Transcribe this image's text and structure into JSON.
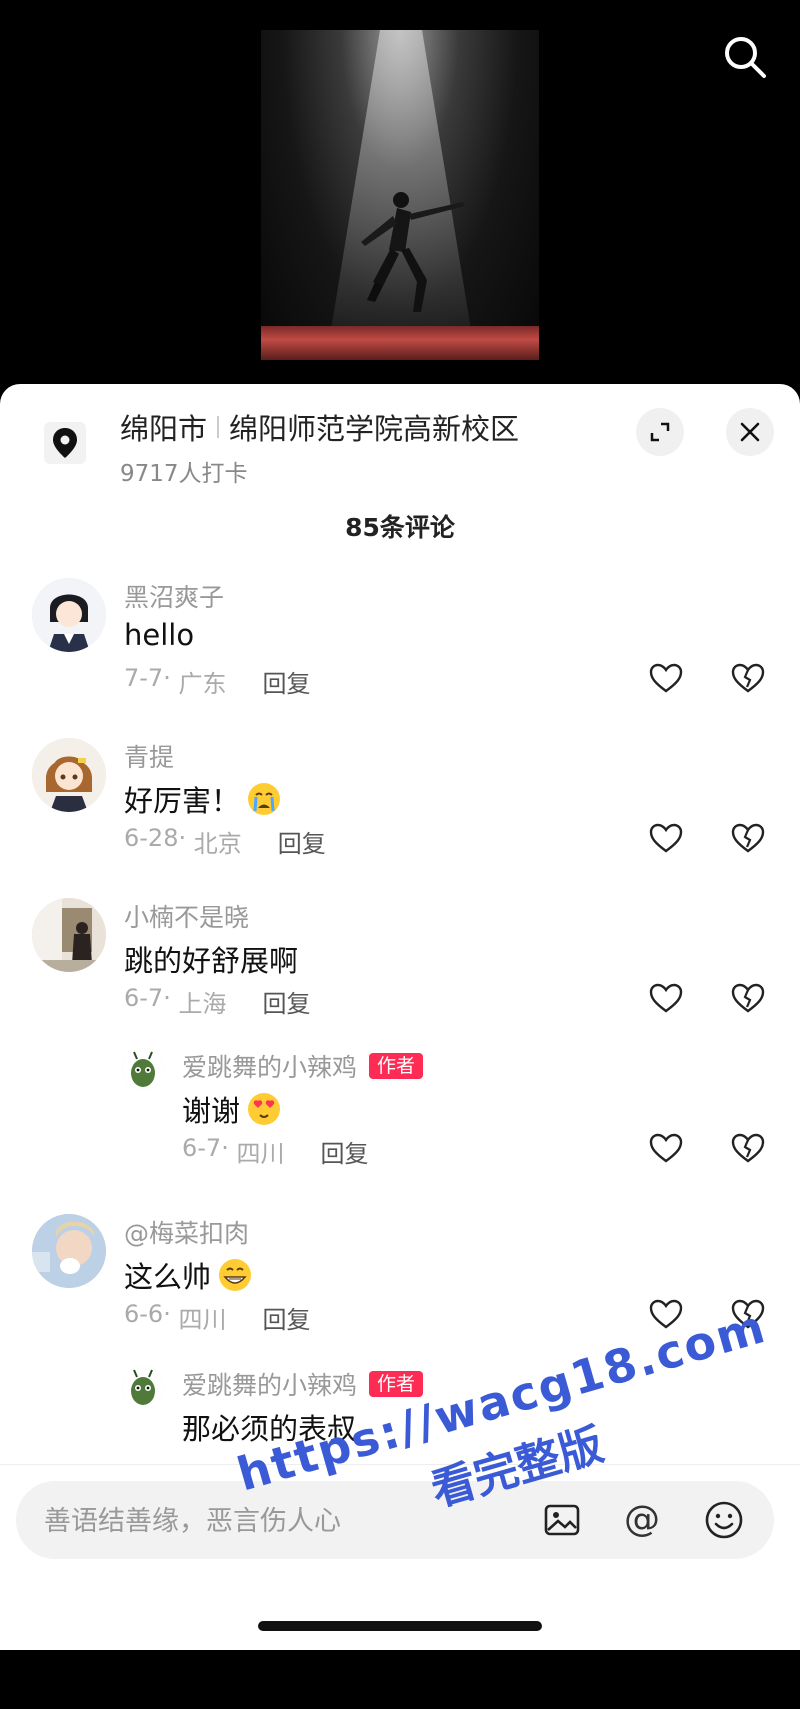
{
  "video": {
    "icons": {
      "search": "search-icon"
    }
  },
  "location": {
    "city": "绵阳市",
    "place": "绵阳师范学院高新校区",
    "checkins": "9717人打卡",
    "icons": {
      "pin": "location-pin-icon",
      "expand": "expand-icon",
      "close": "close-icon"
    }
  },
  "comments_header": {
    "count_label": "85条评论"
  },
  "comments": [
    {
      "user": "黑沼爽子",
      "text": "hello",
      "emoji": "",
      "date": "7-7",
      "region": "广东",
      "reply_label": "回复",
      "avatar_color": "#e8ecf4"
    },
    {
      "user": "青提",
      "text": "好厉害！",
      "emoji": "crying-emoji",
      "date": "6-28",
      "region": "北京",
      "reply_label": "回复",
      "avatar_color": "#d9b07a"
    },
    {
      "user": "小楠不是晓",
      "text": "跳的好舒展啊",
      "emoji": "",
      "date": "6-7",
      "region": "上海",
      "reply_label": "回复",
      "avatar_color": "#c8bfb2"
    },
    {
      "user": "爱跳舞的小辣鸡",
      "badge": "作者",
      "text": "谢谢",
      "emoji": "heart-eyes-emoji",
      "date": "6-7",
      "region": "四川",
      "reply_label": "回复",
      "avatar_color": "#4f7a3a"
    },
    {
      "user": "@梅菜扣肉",
      "text": "这么帅",
      "emoji": "grinning-emoji",
      "date": "6-6",
      "region": "四川",
      "reply_label": "回复",
      "avatar_color": "#8aa4c8"
    },
    {
      "user": "爱跳舞的小辣鸡",
      "badge": "作者",
      "text": "那必须的表叔",
      "emoji": "",
      "date": "",
      "region": "",
      "reply_label": "",
      "avatar_color": "#4f7a3a"
    }
  ],
  "input": {
    "placeholder": "善语结善缘，恶言伤人心",
    "at_symbol": "@",
    "icons": {
      "image": "image-icon",
      "at": "at-icon",
      "emoji": "emoji-icon"
    }
  },
  "watermark": {
    "url": "https://wacg18.com",
    "sub": "看完整版"
  },
  "colors": {
    "author_badge": "#fe2c55",
    "watermark": "#3b5bd6",
    "sheet": "#ffffff"
  }
}
